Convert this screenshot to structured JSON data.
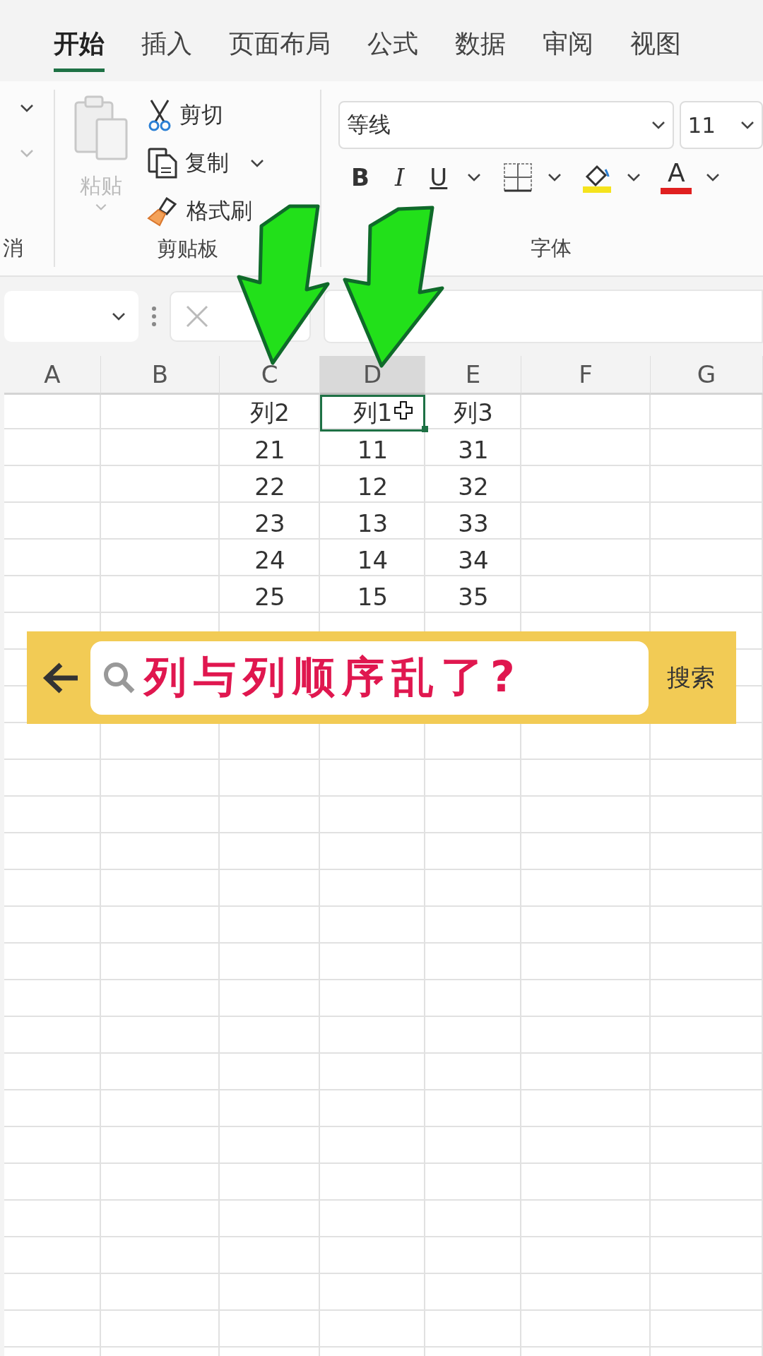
{
  "tabs": [
    {
      "label": "开始",
      "selected": true
    },
    {
      "label": "插入",
      "selected": false
    },
    {
      "label": "页面布局",
      "selected": false
    },
    {
      "label": "公式",
      "selected": false
    },
    {
      "label": "数据",
      "selected": false
    },
    {
      "label": "审阅",
      "selected": false
    },
    {
      "label": "视图",
      "selected": false
    }
  ],
  "ribbon": {
    "undo_group": {
      "label": "消"
    },
    "clipboard": {
      "paste": {
        "label": "粘贴",
        "disabled": true
      },
      "cut": "剪切",
      "copy": "复制",
      "format_painter": "格式刷",
      "label": "剪贴板"
    },
    "font": {
      "font_name": "等线",
      "font_size": "11",
      "bold": "B",
      "italic": "I",
      "underline": "U",
      "font_color": "A",
      "label": "字体"
    }
  },
  "sheet": {
    "columns": [
      {
        "header": "A",
        "selected": false
      },
      {
        "header": "B",
        "selected": false
      },
      {
        "header": "C",
        "selected": false,
        "cells": [
          "列2",
          "21",
          "22",
          "23",
          "24",
          "25"
        ]
      },
      {
        "header": "D",
        "selected": true,
        "cells": [
          "列1",
          "11",
          "12",
          "13",
          "14",
          "15"
        ]
      },
      {
        "header": "E",
        "selected": false,
        "cells": [
          "列3",
          "31",
          "32",
          "33",
          "34",
          "35"
        ]
      },
      {
        "header": "F",
        "selected": false
      },
      {
        "header": "G",
        "selected": false
      }
    ]
  },
  "search_banner": {
    "query": "列与列顺序乱了?",
    "button": "搜索"
  }
}
